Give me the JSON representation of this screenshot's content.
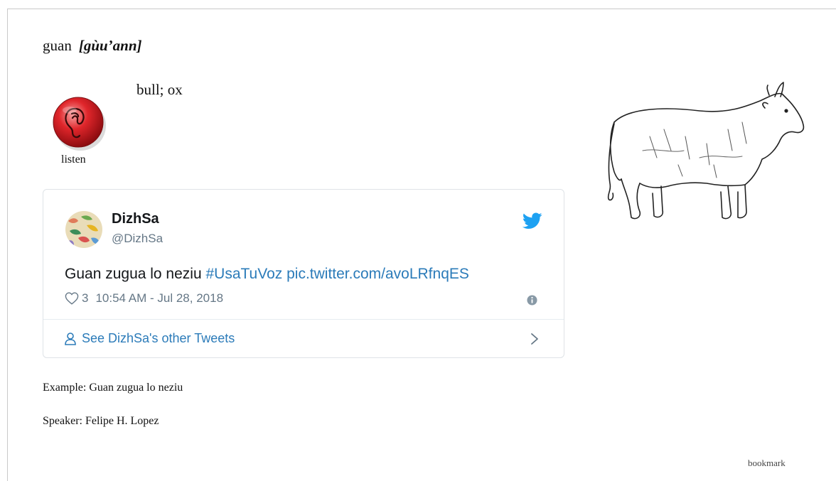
{
  "entry": {
    "word": "guan",
    "pronunciation": "[gùu’ann]",
    "definition": "bull; ox",
    "listen_label": "listen",
    "listen_icon": "ear-icon",
    "image_icon": "bull-illustration"
  },
  "tweet": {
    "name": "DizhSa",
    "handle": "@DizhSa",
    "text_plain": "Guan zugua lo neziu",
    "hashtag": "#UsaTuVoz",
    "link": "pic.twitter.com/avoLRfnqES",
    "likes": "3",
    "timestamp": "10:54 AM - Jul 28, 2018",
    "other_tweets": "See DizhSa's other Tweets",
    "colors": {
      "link": "#2b7bb9",
      "bird": "#1da1f2",
      "muted": "#657786"
    }
  },
  "example": "Example: Guan zugua lo neziu",
  "speaker": "Speaker: Felipe H. Lopez",
  "bookmark": "bookmark"
}
